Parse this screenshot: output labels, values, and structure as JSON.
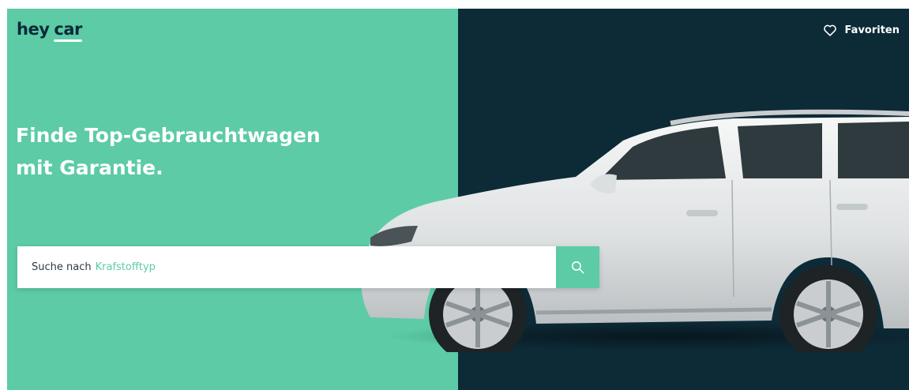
{
  "colors": {
    "mint": "#5ccba6",
    "navy": "#0d2a37",
    "white": "#ffffff",
    "accent_text": "#5ccba6"
  },
  "header": {
    "logo_part1": "hey",
    "logo_part2": "car",
    "favorites_label": "Favoriten",
    "favorites_icon": "heart-icon"
  },
  "hero": {
    "headline_line1": "Finde Top-Gebrauchtwagen",
    "headline_line2": "mit Garantie."
  },
  "search": {
    "prefix": "Suche nach",
    "highlight": "Krafstofftyp",
    "button_icon": "search-icon"
  }
}
